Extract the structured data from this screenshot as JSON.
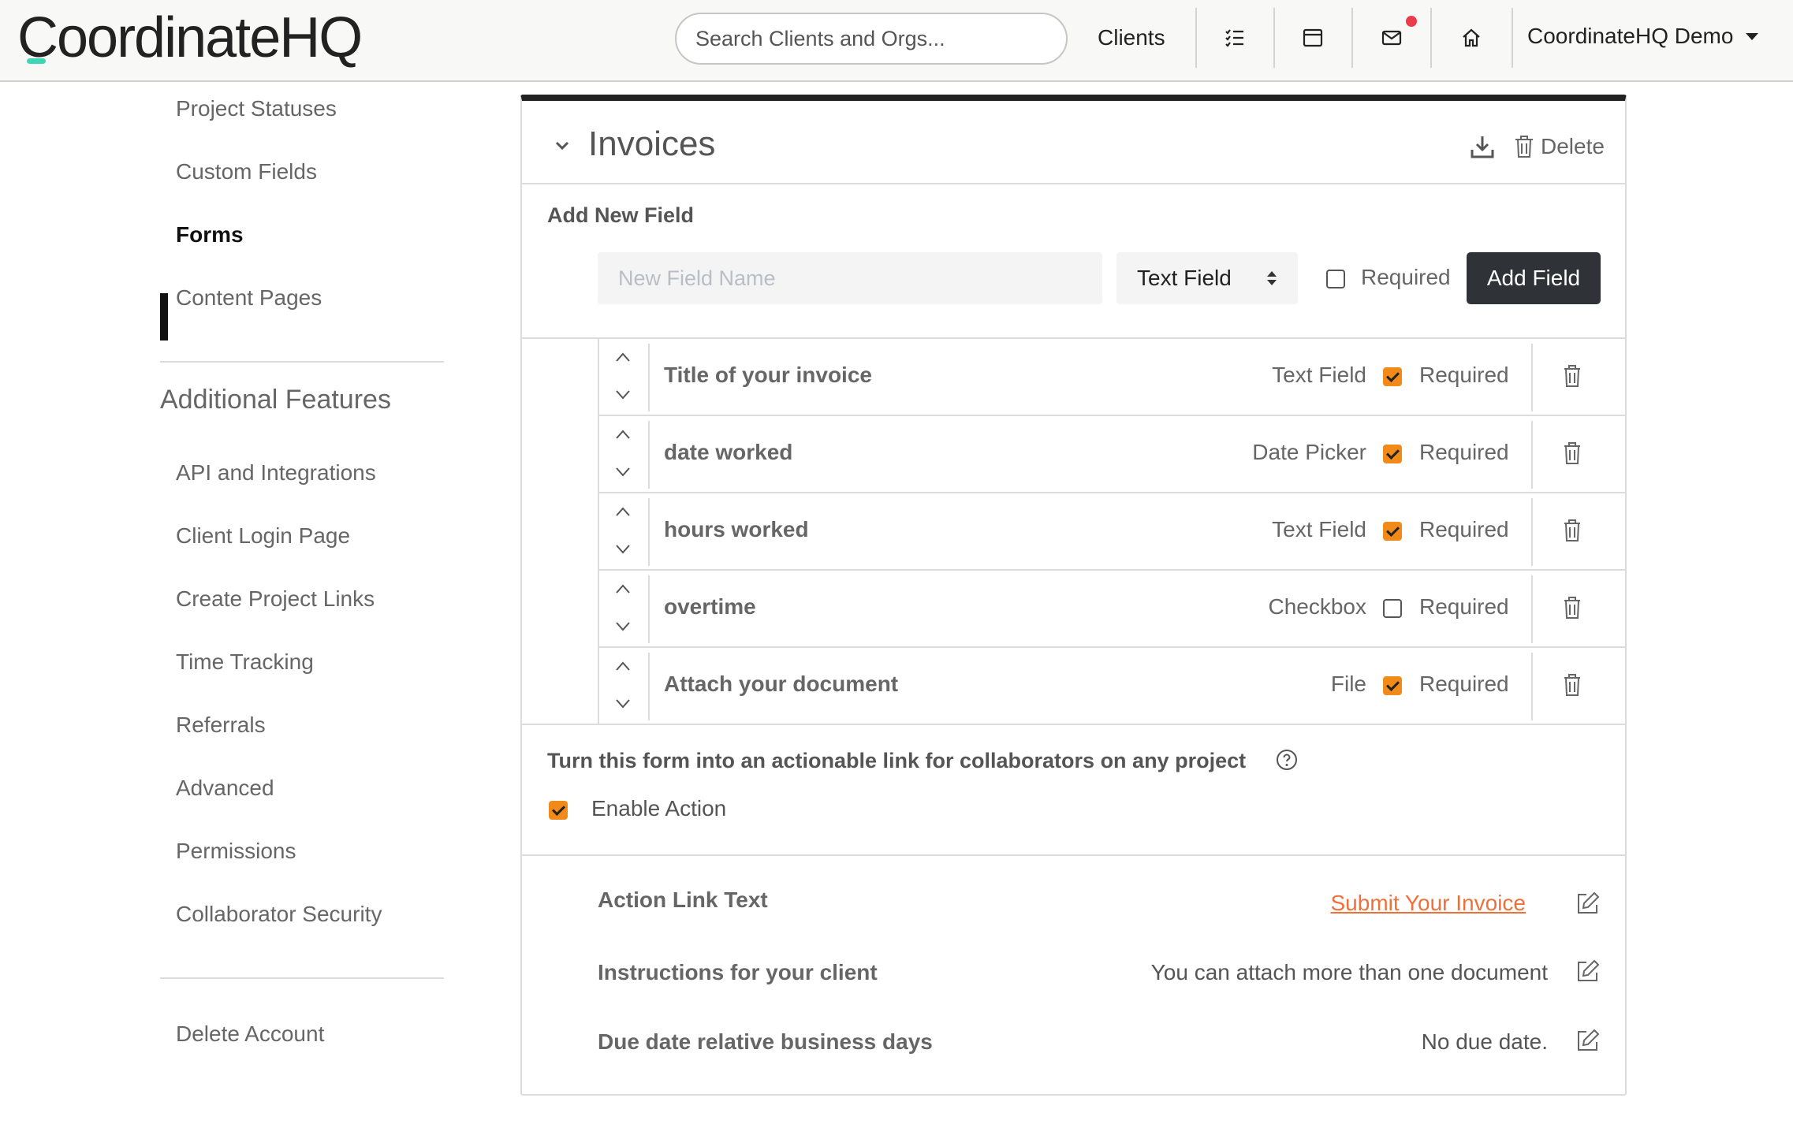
{
  "header": {
    "logo": "CoordinateHQ",
    "search_placeholder": "Search Clients and Orgs...",
    "clients_label": "Clients",
    "account_label": "CoordinateHQ Demo",
    "icons": [
      "checklist-icon",
      "calendar-icon",
      "mail-icon",
      "home-icon"
    ],
    "notification_color": "#ec3b4b"
  },
  "sidebar": {
    "top_items": [
      {
        "label": "Project Statuses"
      },
      {
        "label": "Custom Fields"
      },
      {
        "label": "Forms",
        "active": true
      },
      {
        "label": "Content Pages"
      }
    ],
    "section_heading": "Additional Features",
    "feature_items": [
      {
        "label": "API and Integrations"
      },
      {
        "label": "Client Login Page"
      },
      {
        "label": "Create Project Links"
      },
      {
        "label": "Time Tracking"
      },
      {
        "label": "Referrals"
      },
      {
        "label": "Advanced"
      },
      {
        "label": "Permissions"
      },
      {
        "label": "Collaborator Security"
      }
    ],
    "bottom_item": "Delete Account"
  },
  "form": {
    "title": "Invoices",
    "delete_label": "Delete",
    "add_new_field_label": "Add New Field",
    "new_field_placeholder": "New Field Name",
    "new_field_type": "Text Field",
    "new_field_required_label": "Required",
    "new_field_required": false,
    "add_field_button": "Add Field",
    "fields": [
      {
        "name": "Title of your invoice",
        "type": "Text Field",
        "required": true,
        "required_label": "Required"
      },
      {
        "name": "date worked",
        "type": "Date Picker",
        "required": true,
        "required_label": "Required"
      },
      {
        "name": "hours worked",
        "type": "Text Field",
        "required": true,
        "required_label": "Required"
      },
      {
        "name": "overtime",
        "type": "Checkbox",
        "required": false,
        "required_label": "Required"
      },
      {
        "name": "Attach your document",
        "type": "File",
        "required": true,
        "required_label": "Required"
      }
    ],
    "action_prompt": "Turn this form into an actionable link for collaborators on any project",
    "enable_action_label": "Enable Action",
    "enable_action": true,
    "settings": {
      "action_link_label": "Action Link Text",
      "action_link_value": "Submit Your Invoice",
      "instructions_label": "Instructions for your client",
      "instructions_value": "You can attach more than one document",
      "due_date_label": "Due date relative business days",
      "due_date_value": "No due date."
    },
    "colors": {
      "accent_orange": "#f28a1a",
      "link_orange": "#f0703a",
      "dark_button": "#2f3337"
    }
  }
}
